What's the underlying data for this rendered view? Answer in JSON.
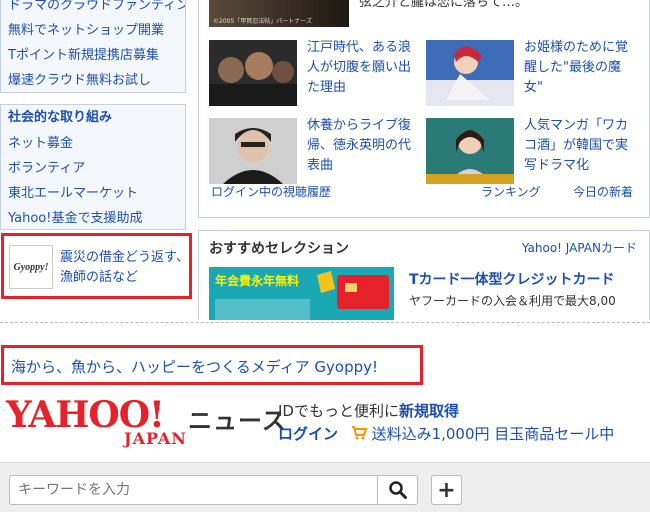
{
  "left_services": {
    "items": [
      "ドラマのクラウドファンディング広告",
      "無料でネットショップ開業",
      "Tポイント新規提携店募集",
      "爆速クラウド無料お試し"
    ]
  },
  "social": {
    "header": "社会的な取り組み",
    "items": [
      "ネット募金",
      "ボランティア",
      "東北エールマーケット",
      "Yahoo!基金で支援助成"
    ]
  },
  "promo": {
    "logo_text": "Gyoppy!",
    "text": "震災の借金どう返す、漁師の話など"
  },
  "video_panel": {
    "top_text": "弦之介と朧は恋に落ちて…。",
    "top_caption": "©2005「甲賀忍法帖」パートナーズ",
    "items": [
      {
        "text": "江戸時代、ある浪人が切腹を願い出た理由"
      },
      {
        "text": "お姫様のために覚醒した\"最後の魔女\""
      },
      {
        "text": "休養からライブ復帰、徳永英明の代表曲"
      },
      {
        "text": "人気マンガ「ワカコ酒」が韓国で実写ドラマ化"
      }
    ],
    "footer": {
      "history": "ログイン中の視聴履歴",
      "ranking": "ランキング",
      "today": "今日の新着"
    }
  },
  "selection": {
    "title": "おすすめセレクション",
    "partner": "Yahoo! JAPANカード",
    "card_badge": "年会費永年無料",
    "card_head": "Tカード一体型クレジットカード",
    "card_sub": "ヤフーカードの入会＆利用で最大8,00"
  },
  "banner": {
    "text": "海から、魚から、ハッピーをつくるメディア Gyoppy!"
  },
  "header": {
    "logo_word": "YAHOO!",
    "logo_sub": "JAPAN",
    "service": "ニュース",
    "line1_prefix": "IDでもっと便利に",
    "line1_link": "新規取得",
    "login": "ログイン",
    "shipping": "送料込み1,000円 目玉商品セール中"
  },
  "search": {
    "placeholder": "キーワードを入力"
  },
  "colors": {
    "accent_red": "#e5222b",
    "link_blue": "#1d4fae"
  }
}
